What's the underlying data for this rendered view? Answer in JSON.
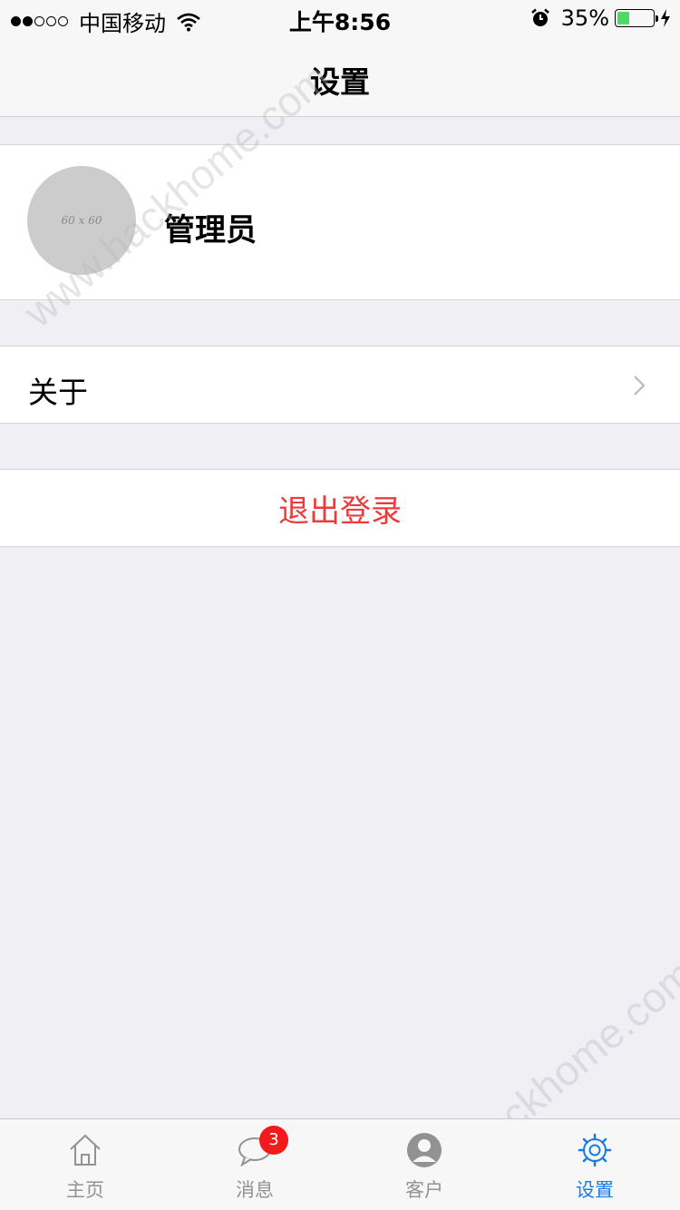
{
  "status_bar": {
    "carrier": "中国移动",
    "time": "上午8:56",
    "battery_percent_text": "35%",
    "battery_level": 0.35,
    "signal_bars_filled": 2,
    "signal_bars_total": 5,
    "icons": [
      "wifi-icon",
      "alarm-icon",
      "battery-icon",
      "bolt-icon"
    ]
  },
  "nav": {
    "title": "设置"
  },
  "profile": {
    "avatar_placeholder": "60 x 60",
    "name": "管理员"
  },
  "menu": {
    "about_label": "关于",
    "logout_label": "退出登录"
  },
  "watermark": {
    "top": "www.hackhome.com",
    "bottom": "www.hackhome.com"
  },
  "tabs": [
    {
      "label": "主页",
      "icon": "home-icon",
      "active": false
    },
    {
      "label": "消息",
      "icon": "chat-bubble-icon",
      "active": false,
      "badge": "3"
    },
    {
      "label": "客户",
      "icon": "user-avatar-icon",
      "active": false
    },
    {
      "label": "设置",
      "icon": "gear-icon",
      "active": true
    }
  ],
  "colors": {
    "accent": "#1a7ae6",
    "logout": "#ed3b3b",
    "badge": "#f21a1a",
    "battery": "#4cd964",
    "background": "#efeff4"
  }
}
